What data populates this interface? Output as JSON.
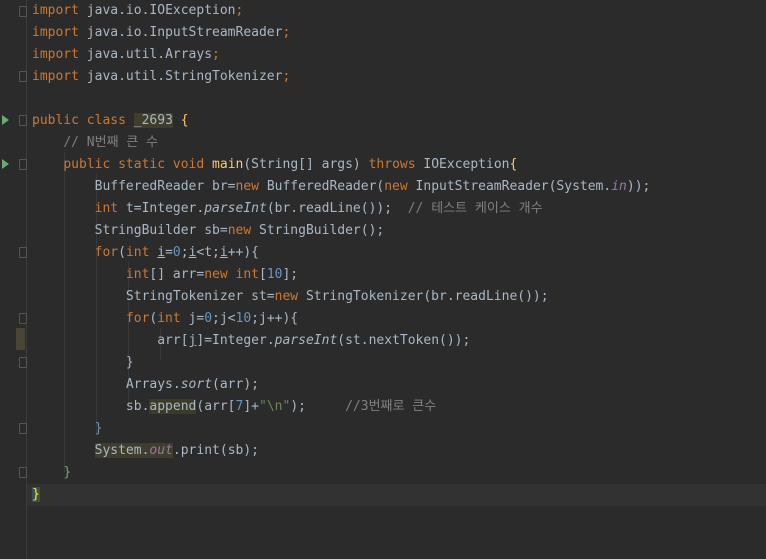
{
  "code": {
    "imports": [
      {
        "kw": "import",
        "path": "java.io.IOException",
        "semi": ";"
      },
      {
        "kw": "import",
        "path": "java.io.InputStreamReader",
        "semi": ";"
      },
      {
        "kw": "import",
        "path": "java.util.Arrays",
        "semi": ";"
      },
      {
        "kw": "import",
        "path": "java.util.StringTokenizer",
        "semi": ";"
      }
    ],
    "class_decl": {
      "public": "public",
      "class": "class",
      "name": "_2693",
      "open": "{"
    },
    "comment_main": "// N번째 큰 수",
    "main_sig": {
      "public": "public",
      "static": "static",
      "void": "void",
      "name": "main",
      "params": "(String[] args) ",
      "throws": "throws",
      "exc": "IOException",
      "open": "{"
    },
    "line_br": {
      "a": "BufferedReader br=",
      "new1": "new",
      "b": " BufferedReader(",
      "new2": "new",
      "c": " InputStreamReader(System.",
      "in": "in",
      "d": "));"
    },
    "line_t": {
      "int": "int",
      "a": " t=Integer.",
      "parse": "parseInt",
      "b": "(br.readLine());  ",
      "cm": "// 테스트 케이스 개수"
    },
    "line_sb": {
      "a": "StringBuilder sb=",
      "new": "new",
      "b": " StringBuilder();"
    },
    "line_for1": {
      "for": "for",
      "a": "(",
      "int": "int",
      "b": " ",
      "i1": "i",
      "c": "=",
      "n0": "0",
      "d": ";",
      "i2": "i",
      "e": "<t;",
      "i3": "i",
      "f": "++){"
    },
    "line_arr": {
      "int1": "int",
      "a": "[] arr=",
      "new": "new",
      "b": " ",
      "int2": "int",
      "c": "[",
      "n10": "10",
      "d": "];"
    },
    "line_st": {
      "a": "StringTokenizer st=",
      "new": "new",
      "b": " StringTokenizer(br.readLine());"
    },
    "line_for2": {
      "for": "for",
      "a": "(",
      "int": "int",
      "b": " j=",
      "n0": "0",
      "c": ";j<",
      "n10": "10",
      "d": ";j++){"
    },
    "line_assign": {
      "a": "arr[",
      "j": "j",
      "b": "]=Integer.",
      "parse": "parseInt",
      "c": "(st.nextToken());"
    },
    "close1": "}",
    "line_sort": {
      "a": "Arrays.",
      "sort": "sort",
      "b": "(arr);"
    },
    "line_append": {
      "a": "sb.",
      "append": "append",
      "b": "(arr[",
      "n7": "7",
      "c": "]+",
      "str": "\"\\n\"",
      "d": ");     ",
      "cm": "//3번째로 큰수"
    },
    "close2": "}",
    "line_print": {
      "sys": "System.",
      "out": "out",
      "b": ".print(sb);"
    },
    "close3": "}",
    "close4": "}"
  }
}
